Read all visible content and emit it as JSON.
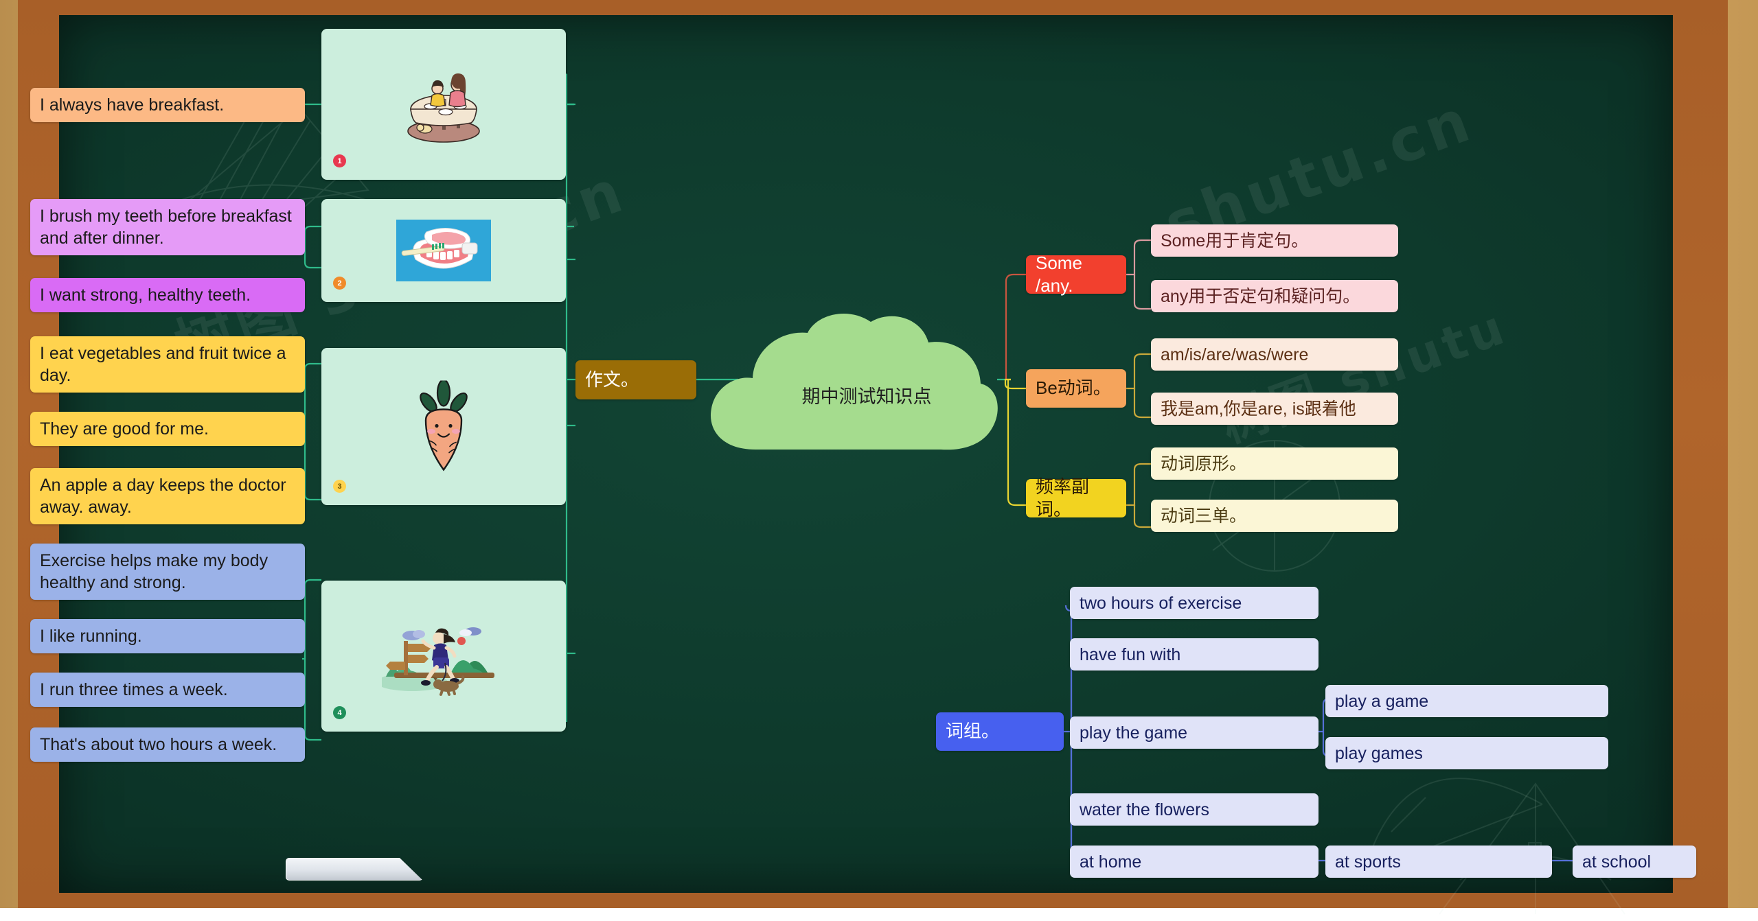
{
  "board": {
    "eraser_label": "chalk-eraser",
    "watermarks": [
      "树图 shutu.cn",
      "https://shutu.cn"
    ]
  },
  "center": {
    "title": "期中测试知识点"
  },
  "branches": {
    "composition": {
      "label": "作文。",
      "color": "#9a6d06",
      "cards": [
        {
          "badge": "1",
          "badge_color": "#e8384f",
          "art": "family-dining-table-illustration"
        },
        {
          "badge": "2",
          "badge_color": "#f08b2a",
          "art": "teeth-model-toothbrush-photo"
        },
        {
          "badge": "3",
          "badge_color": "#ffd34e",
          "art": "smiling-carrot-illustration"
        },
        {
          "badge": "4",
          "badge_color": "#1e8f5a",
          "art": "woman-jogging-with-dog-illustration"
        }
      ],
      "sentences": [
        {
          "text": "I always have breakfast.",
          "color": "#fcb985",
          "group": 1
        },
        {
          "text": "I brush my teeth  before breakfast and after dinner.",
          "color": "#e59bf7",
          "group": 2
        },
        {
          "text": "I want strong, healthy teeth.",
          "color": "#d96bf5",
          "group": 2
        },
        {
          "text": " I eat vegetables and fruit twice a day.",
          "color": "#ffd34e",
          "group": 3
        },
        {
          "text": "They are good for me.",
          "color": "#ffd34e",
          "group": 3
        },
        {
          "text": " An apple a day keeps the doctor away. away.",
          "color": "#ffd34e",
          "group": 3
        },
        {
          "text": "Exercise helps make my body healthy and strong.",
          "color": "#9bb2e8",
          "group": 4
        },
        {
          "text": "I like running.",
          "color": "#9bb2e8",
          "group": 4
        },
        {
          "text": "I run three times a week.",
          "color": "#9bb2e8",
          "group": 4
        },
        {
          "text": "That's about two hours a week.",
          "color": "#9bb2e8",
          "group": 4
        }
      ]
    },
    "grammar": [
      {
        "label": "Some /any.",
        "color": "#f2402e",
        "children": [
          {
            "text": "Some用于肯定句。",
            "color": "#fbd8dc"
          },
          {
            "text": "any用于否定句和疑问句。",
            "color": "#fbd8dc"
          }
        ]
      },
      {
        "label": "Be动词。",
        "color": "#f5a45c",
        "children": [
          {
            "text": "am/is/are/was/were",
            "color": "#fbeade"
          },
          {
            "text": "我是am,你是are, is跟着他",
            "color": "#fbeade"
          }
        ]
      },
      {
        "label": "频率副词。",
        "color": "#f2d320",
        "children": [
          {
            "text": "动词原形。",
            "color": "#fbf6d6"
          },
          {
            "text": "动词三单。",
            "color": "#fbf6d6"
          }
        ]
      }
    ],
    "phrases": {
      "label": "词组。",
      "color": "#4760ef",
      "items": [
        {
          "text": "two hours of exercise",
          "children": []
        },
        {
          "text": "have fun with",
          "children": []
        },
        {
          "text": "play the game",
          "children": [
            "play a game",
            "play games"
          ]
        },
        {
          "text": "water the flowers",
          "children": []
        },
        {
          "text": "at home",
          "children": [
            "at sports"
          ],
          "grandchildren": [
            "at school"
          ]
        }
      ],
      "at_sports": "at sports",
      "at_school": "at school"
    }
  }
}
